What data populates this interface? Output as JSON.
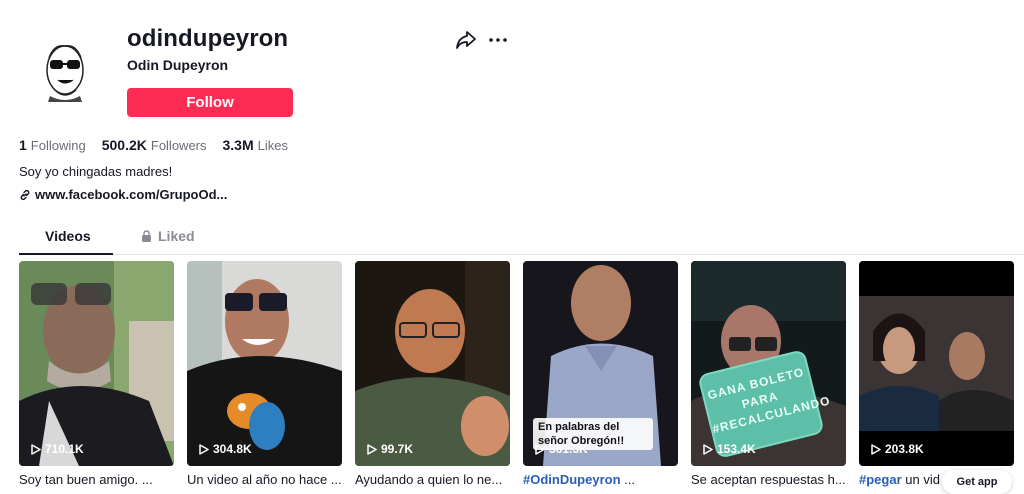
{
  "profile": {
    "username": "odindupeyron",
    "nickname": "Odin Dupeyron",
    "follow_label": "Follow",
    "bio": "Soy yo chingadas madres!",
    "link": "www.facebook.com/GrupoOd..."
  },
  "stats": [
    {
      "value": "1",
      "label": "Following"
    },
    {
      "value": "500.2K",
      "label": "Followers"
    },
    {
      "value": "3.3M",
      "label": "Likes"
    }
  ],
  "tabs": {
    "videos": "Videos",
    "liked": "Liked"
  },
  "videos": [
    {
      "views": "710.1K",
      "caption": "Soy tan buen amigo. ..."
    },
    {
      "views": "304.8K",
      "caption": "Un video al año no hace ..."
    },
    {
      "views": "99.7K",
      "caption": "Ayudando a quien lo ne..."
    },
    {
      "views": "361.3K",
      "caption_tag": "#OdinDupeyron",
      "caption": " ...",
      "overlay": "En palabras del señor Obregón!!"
    },
    {
      "views": "153.4K",
      "caption": "Se aceptan respuestas h...",
      "sticker": "GANA BOLETO PARA #RECALCULANDO"
    },
    {
      "views": "203.8K",
      "caption_tag": "#pegar",
      "caption": " un vid"
    }
  ],
  "get_app": "Get app",
  "colors": {
    "follow_button": "#fe2c55",
    "hashtag": "#2b5db9",
    "text_primary": "#161823",
    "text_secondary": "#6b6d74"
  },
  "icons": [
    "share-icon",
    "more-icon",
    "link-icon",
    "lock-icon",
    "play-icon"
  ]
}
